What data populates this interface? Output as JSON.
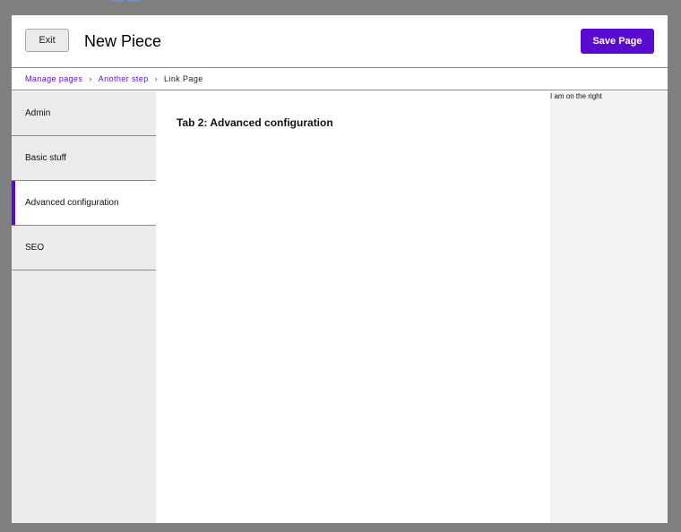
{
  "header": {
    "exit_label": "Exit",
    "title": "New Piece",
    "save_label": "Save Page"
  },
  "breadcrumb": {
    "items": [
      {
        "label": "Manage pages",
        "link": true
      },
      {
        "label": "Another step",
        "link": true
      },
      {
        "label": "Link Page",
        "link": false
      }
    ],
    "separator": "›"
  },
  "sidebar": {
    "items": [
      {
        "label": "Admin",
        "active": false
      },
      {
        "label": "Basic stuff",
        "active": false
      },
      {
        "label": "Advanced configuration",
        "active": true
      },
      {
        "label": "SEO",
        "active": false
      }
    ]
  },
  "content": {
    "heading": "Tab 2: Advanced configuration"
  },
  "right_panel": {
    "text": "I am on the right"
  },
  "colors": {
    "accent": "#5a0bd1",
    "overlay": "#7f7f7f",
    "sidebar_bg": "#ebebeb",
    "right_panel_bg": "#f2f2f2"
  }
}
